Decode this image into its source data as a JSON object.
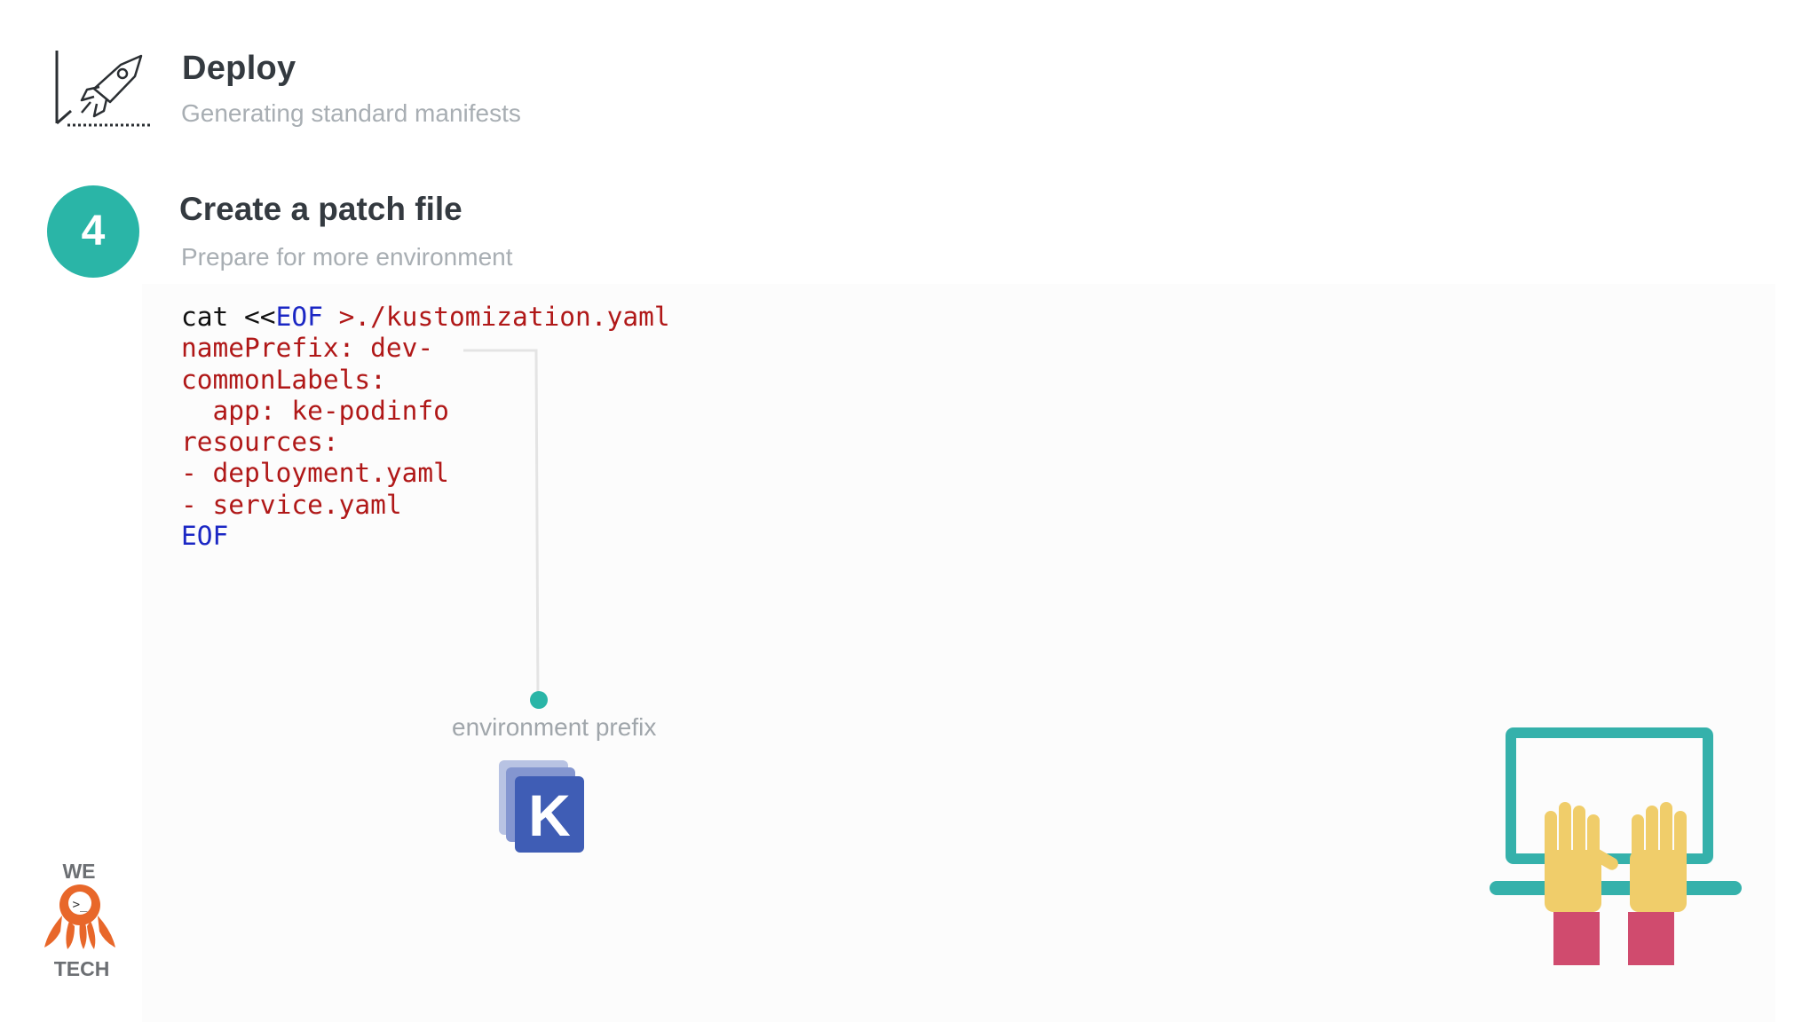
{
  "section": {
    "icon": "rocket-chart-icon",
    "title": "Deploy",
    "subtitle": "Generating standard manifests"
  },
  "step": {
    "number": "4",
    "title": "Create a patch file",
    "subtitle": "Prepare for more environment"
  },
  "code": {
    "line1": {
      "cmd": "cat <<",
      "delim": "EOF",
      "target": " >./kustomization.yaml"
    },
    "line2": "namePrefix: dev-",
    "line3": "commonLabels:",
    "line4": "  app: ke-podinfo",
    "line5": "resources:",
    "line6": "- deployment.yaml",
    "line7": "- service.yaml",
    "line8": "EOF"
  },
  "annotation": {
    "label": "environment prefix",
    "icon": "kustomize-logo-icon",
    "logo_letter": "K"
  },
  "branding": {
    "logo_top": "WE",
    "logo_bottom": "TECH",
    "icon": "octopus-mascot-icon"
  },
  "illustration": {
    "icon": "laptop-typing-hands-icon"
  },
  "colors": {
    "accent": "#2ab5a7",
    "code_keyword": "#1b27c4",
    "code_string": "#b01818",
    "kustomize_blue": "#3f5db5",
    "mascot_orange": "#e8672a",
    "hands_yellow": "#f0cd6a",
    "sleeve_pink": "#d04b6e"
  }
}
